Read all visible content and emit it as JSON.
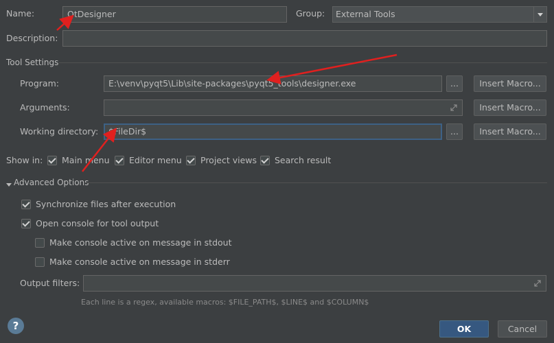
{
  "general": {
    "name_label": "Name:",
    "name_value": "QtDesigner",
    "group_label": "Group:",
    "group_value": "External Tools",
    "description_label": "Description:",
    "description_value": ""
  },
  "tool_settings": {
    "section_title": "Tool Settings",
    "program_label": "Program:",
    "program_value": "E:\\venv\\pyqt5\\Lib\\site-packages\\pyqt5_tools\\designer.exe",
    "arguments_label": "Arguments:",
    "arguments_value": "",
    "working_dir_label": "Working directory:",
    "working_dir_value": "$FileDir$",
    "browse_label": "...",
    "insert_macro_label": "Insert Macro..."
  },
  "show_in": {
    "label": "Show in:",
    "options": [
      {
        "label": "Main menu",
        "checked": true
      },
      {
        "label": "Editor menu",
        "checked": true
      },
      {
        "label": "Project views",
        "checked": true
      },
      {
        "label": "Search result",
        "checked": true
      }
    ]
  },
  "advanced": {
    "title": "Advanced Options",
    "options": [
      {
        "label": "Synchronize files after execution",
        "checked": true
      },
      {
        "label": "Open console for tool output",
        "checked": true
      },
      {
        "label": "Make console active on message in stdout",
        "checked": false
      },
      {
        "label": "Make console active on message in stderr",
        "checked": false
      }
    ],
    "output_filters_label": "Output filters:",
    "output_filters_value": "",
    "hint": "Each line is a regex, available macros: $FILE_PATH$, $LINE$ and $COLUMN$"
  },
  "footer": {
    "help_glyph": "?",
    "ok_label": "OK",
    "cancel_label": "Cancel"
  },
  "colors": {
    "background": "#3c3f41",
    "field": "#45494a",
    "focus_border": "#3d6185",
    "ok_button": "#365880",
    "annotation_arrow": "#e0201f"
  }
}
